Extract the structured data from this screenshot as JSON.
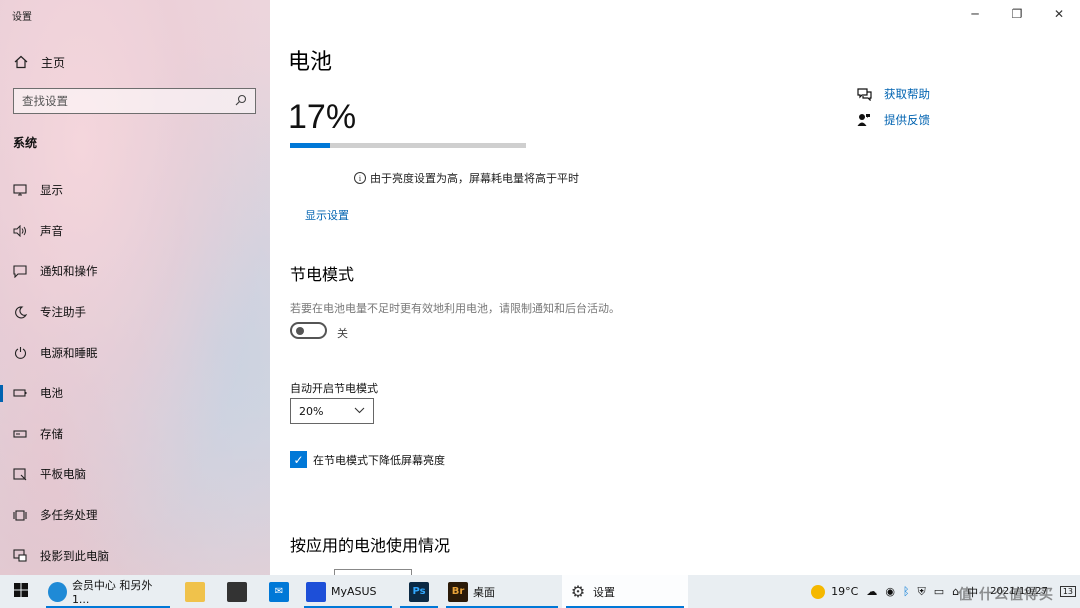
{
  "window": {
    "title": "设置",
    "minimize": "─",
    "restore": "❐",
    "close": "✕"
  },
  "sidebar": {
    "home_label": "主页",
    "search_placeholder": "查找设置",
    "section": "系统",
    "items": [
      {
        "label": "显示",
        "icon": "monitor-icon"
      },
      {
        "label": "声音",
        "icon": "speaker-icon"
      },
      {
        "label": "通知和操作",
        "icon": "notification-icon"
      },
      {
        "label": "专注助手",
        "icon": "moon-icon"
      },
      {
        "label": "电源和睡眠",
        "icon": "power-icon"
      },
      {
        "label": "电池",
        "icon": "battery-icon",
        "active": true
      },
      {
        "label": "存储",
        "icon": "storage-icon"
      },
      {
        "label": "平板电脑",
        "icon": "tablet-icon"
      },
      {
        "label": "多任务处理",
        "icon": "multitask-icon"
      },
      {
        "label": "投影到此电脑",
        "icon": "project-icon"
      }
    ]
  },
  "main": {
    "title": "电池",
    "battery_percent_text": "17%",
    "battery_level": 0.17,
    "brightness_warning": "由于亮度设置为高，屏幕耗电量将高于平时",
    "display_settings_link": "显示设置",
    "saver": {
      "title": "节电模式",
      "description": "若要在电池电量不足时更有效地利用电池，请限制通知和后台活动。",
      "toggle_state": "关",
      "auto_label": "自动开启节电模式",
      "auto_value": "20%",
      "lower_brightness_label": "在节电模式下降低屏幕亮度",
      "lower_brightness_checked": true
    },
    "usage_title": "按应用的电池使用情况",
    "help": {
      "get_help": "获取帮助",
      "feedback": "提供反馈"
    }
  },
  "taskbar": {
    "apps": [
      {
        "label": "会员中心 和另外 1...",
        "icon": "edge-icon",
        "color": "#1f8ad6"
      },
      {
        "label": "",
        "icon": "folder-icon",
        "color": "#f0c24b"
      },
      {
        "label": "",
        "icon": "store-icon",
        "color": "#333333"
      },
      {
        "label": "",
        "icon": "mail-icon",
        "color": "#0078d7"
      },
      {
        "label": "MyASUS",
        "icon": "myasus-icon",
        "color": "#1d4fd8"
      },
      {
        "label": "",
        "icon": "photoshop-icon",
        "text": "Ps",
        "color": "#0b2a45"
      },
      {
        "label": "桌面",
        "icon": "bridge-icon",
        "text": "Br",
        "color": "#2b1a08"
      },
      {
        "label": "设置",
        "icon": "settings-gear-icon",
        "color": "#333333"
      }
    ],
    "weather": "19°C",
    "ime": "中",
    "time": "",
    "date": "2021/10/27",
    "notifications": "13",
    "watermark": "值 什么值得买"
  }
}
